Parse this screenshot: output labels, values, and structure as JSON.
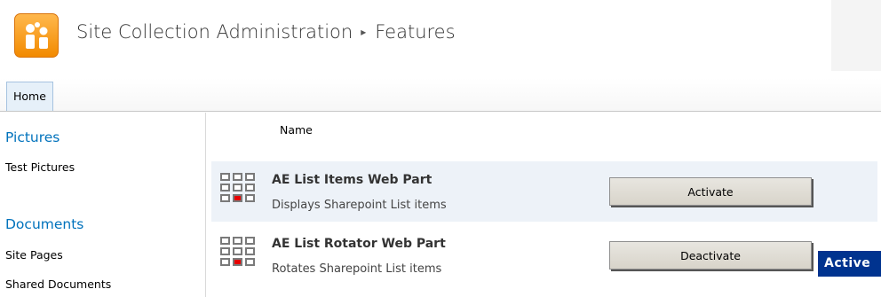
{
  "header": {
    "breadcrumb": [
      "Site Collection Administration",
      "Features"
    ],
    "separator": "▸"
  },
  "ribbon": {
    "tabs": [
      {
        "label": "Home",
        "selected": true
      }
    ]
  },
  "leftnav": {
    "sections": [
      {
        "heading": "Pictures",
        "items": [
          "Test Pictures"
        ]
      },
      {
        "heading": "Documents",
        "items": [
          "Site Pages",
          "Shared Documents"
        ]
      }
    ]
  },
  "main": {
    "column_header": "Name",
    "features": [
      {
        "title": "AE List Items Web Part",
        "description": "Displays Sharepoint List items",
        "action": "Activate",
        "status": ""
      },
      {
        "title": "AE List Rotator Web Part",
        "description": "Rotates Sharepoint List items",
        "action": "Deactivate",
        "status": "Active"
      }
    ]
  },
  "colors": {
    "nav_heading": "#0072bc",
    "status_badge": "#00338f",
    "logo": "#f28a00"
  }
}
